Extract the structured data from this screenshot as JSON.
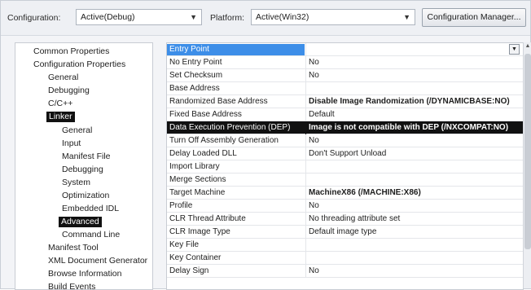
{
  "toolbar": {
    "configuration_label": "Configuration:",
    "configuration_value": "Active(Debug)",
    "platform_label": "Platform:",
    "platform_value": "Active(Win32)",
    "config_manager_label": "Configuration Manager..."
  },
  "tree": {
    "items": [
      {
        "label": "Common Properties"
      },
      {
        "label": "Configuration Properties"
      },
      {
        "label": "General"
      },
      {
        "label": "Debugging"
      },
      {
        "label": "C/C++"
      },
      {
        "label": "Linker",
        "selected": true
      },
      {
        "label": "General"
      },
      {
        "label": "Input"
      },
      {
        "label": "Manifest File"
      },
      {
        "label": "Debugging"
      },
      {
        "label": "System"
      },
      {
        "label": "Optimization"
      },
      {
        "label": "Embedded IDL"
      },
      {
        "label": "Advanced",
        "selected": true
      },
      {
        "label": "Command Line"
      },
      {
        "label": "Manifest Tool"
      },
      {
        "label": "XML Document Generator"
      },
      {
        "label": "Browse Information"
      },
      {
        "label": "Build Events"
      }
    ]
  },
  "grid": {
    "rows": [
      {
        "name": "Entry Point",
        "value": ""
      },
      {
        "name": "No Entry Point",
        "value": "No"
      },
      {
        "name": "Set Checksum",
        "value": "No"
      },
      {
        "name": "Base Address",
        "value": ""
      },
      {
        "name": "Randomized Base Address",
        "value": "Disable Image Randomization (/DYNAMICBASE:NO)"
      },
      {
        "name": "Fixed Base Address",
        "value": "Default"
      },
      {
        "name": "Data Execution Prevention (DEP)",
        "value": "Image is not compatible with DEP (/NXCOMPAT:NO)"
      },
      {
        "name": "Turn Off Assembly Generation",
        "value": "No"
      },
      {
        "name": "Delay Loaded DLL",
        "value": "Don't Support Unload"
      },
      {
        "name": "Import Library",
        "value": ""
      },
      {
        "name": "Merge Sections",
        "value": ""
      },
      {
        "name": "Target Machine",
        "value": "MachineX86 (/MACHINE:X86)"
      },
      {
        "name": "Profile",
        "value": "No"
      },
      {
        "name": "CLR Thread Attribute",
        "value": "No threading attribute set"
      },
      {
        "name": "CLR Image Type",
        "value": "Default image type"
      },
      {
        "name": "Key File",
        "value": ""
      },
      {
        "name": "Key Container",
        "value": ""
      },
      {
        "name": "Delay Sign",
        "value": "No"
      }
    ]
  },
  "icons": {
    "dropdown": "chevron-down-icon",
    "scroll_up": "arrow-up-icon"
  },
  "colors": {
    "selection_blue": "#3d8ee8",
    "highlight_black": "#111111"
  }
}
